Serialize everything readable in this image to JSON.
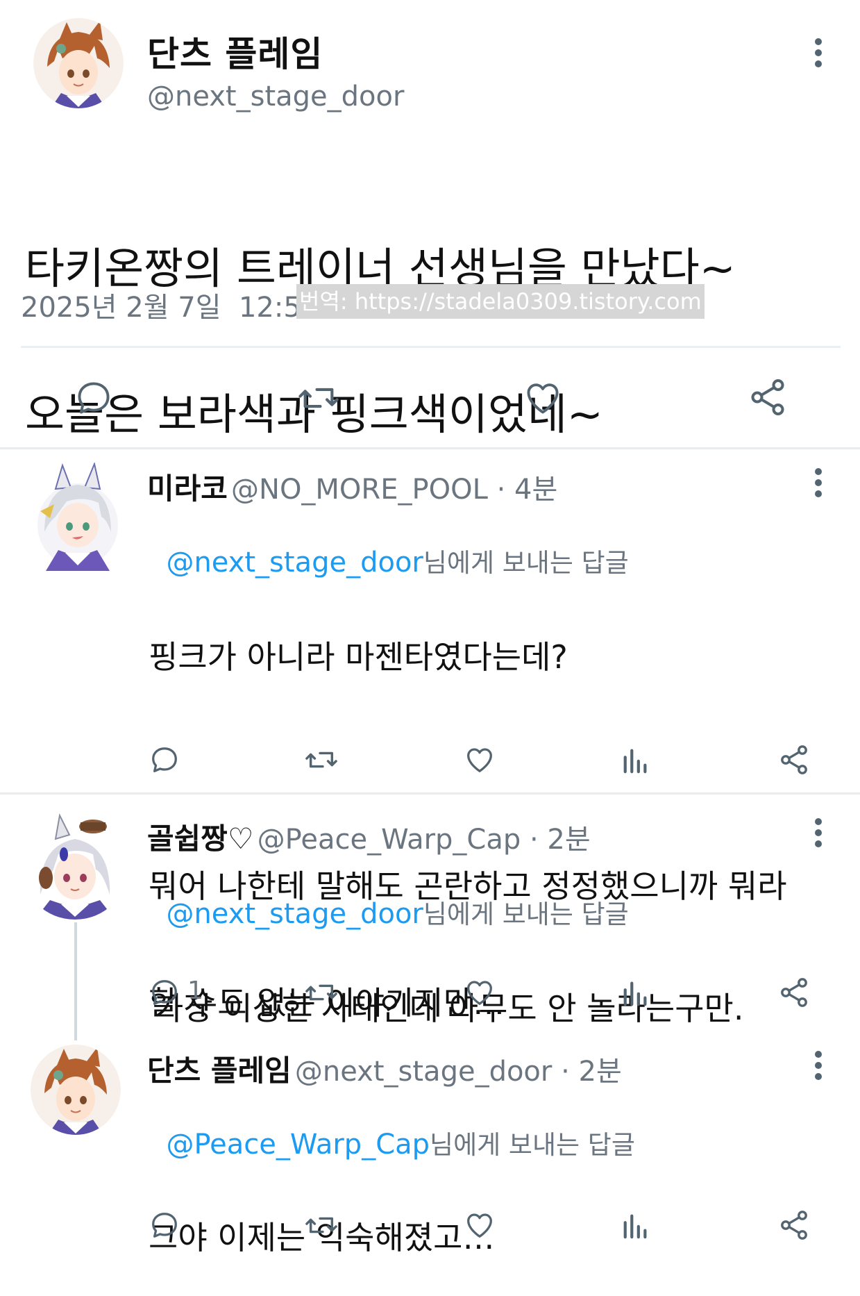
{
  "main_tweet": {
    "display_name": "단츠 플레임",
    "handle": "@next_stage_door",
    "text_line1": "타키온짱의 트레이너 선생님을 만났다~",
    "text_line2": "오늘은 보라색과 핑크색이었네~",
    "timestamp": "2025년 2월 7일  12:51",
    "watermark": "번역: https://stadela0309.tistory.com",
    "actions": [
      "reply-icon",
      "retweet-icon",
      "like-icon",
      "share-icon"
    ]
  },
  "replies": [
    {
      "display_name": "미라코",
      "handle_time": "@NO_MORE_POOL · 4분",
      "reply_to_handle": "@next_stage_door",
      "reply_to_suffix": "님에게 보내는 답글",
      "text_line1": "핑크가 아니라 마젠타였다는데?",
      "text_line2": "뭐어 나한테 말해도 곤란하고 정정했으니까 뭐라",
      "text_line3": "할 수도 없는 이야기지만…",
      "reply_count": ""
    },
    {
      "display_name": "골쉽짱♡",
      "handle_time": "@Peace_Warp_Cap · 2분",
      "reply_to_handle": "@next_stage_door",
      "reply_to_suffix": "님에게 보내는 답글",
      "text_line1": "가장 이상한 사태인데 아무도 안 놀라는구만.",
      "reply_count": "1"
    },
    {
      "display_name": "단츠 플레임",
      "handle_time": "@next_stage_door · 2분",
      "reply_to_handle": "@Peace_Warp_Cap",
      "reply_to_suffix": "님에게 보내는 답글",
      "text_line1": "그야 이제는 익숙해졌고…",
      "reply_count": ""
    }
  ],
  "colors": {
    "link": "#1d9bf0",
    "muted": "#6b7580",
    "text": "#111111"
  }
}
